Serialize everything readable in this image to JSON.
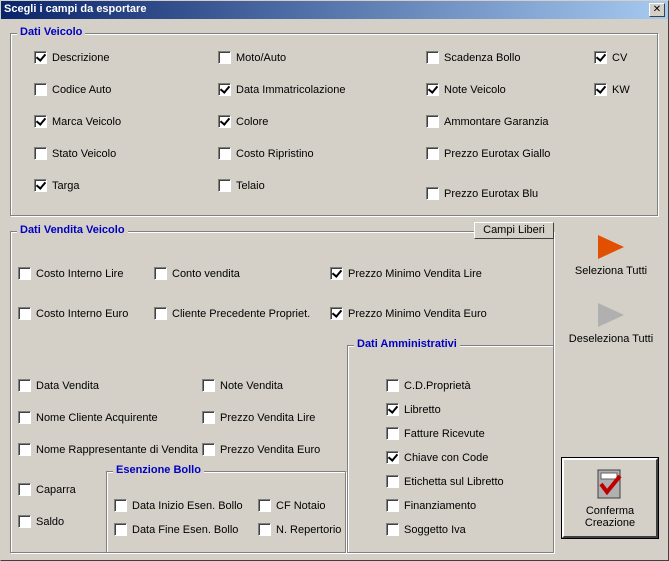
{
  "window": {
    "title": "Scegli i campi da esportare",
    "close_glyph": "✕"
  },
  "groups": {
    "veicolo": {
      "title": "Dati Veicolo"
    },
    "vendita": {
      "title": "Dati Vendita Veicolo"
    },
    "amministrativi": {
      "title": "Dati Amministrativi"
    },
    "esenzione": {
      "title": "Esenzione Bollo"
    }
  },
  "buttons": {
    "campi_liberi": "Campi Liberi",
    "seleziona_tutti": "Seleziona Tutti",
    "deseleziona_tutti": "Deseleziona Tutti",
    "conferma_line1": "Conferma",
    "conferma_line2": "Creazione"
  },
  "checkboxes": {
    "descrizione": {
      "label": "Descrizione",
      "checked": true
    },
    "codice_auto": {
      "label": "Codice Auto",
      "checked": false
    },
    "marca_veicolo": {
      "label": "Marca Veicolo",
      "checked": true
    },
    "stato_veicolo": {
      "label": "Stato Veicolo",
      "checked": false
    },
    "targa": {
      "label": "Targa",
      "checked": true
    },
    "moto_auto": {
      "label": "Moto/Auto",
      "checked": false
    },
    "data_immatricolazione": {
      "label": "Data Immatricolazione",
      "checked": true
    },
    "colore": {
      "label": "Colore",
      "checked": true
    },
    "costo_ripristino": {
      "label": "Costo Ripristino",
      "checked": false
    },
    "telaio": {
      "label": "Telaio",
      "checked": false
    },
    "scadenza_bollo": {
      "label": "Scadenza Bollo",
      "checked": false
    },
    "note_veicolo": {
      "label": "Note Veicolo",
      "checked": true
    },
    "ammontare_garanzia": {
      "label": "Ammontare Garanzia",
      "checked": false
    },
    "prezzo_eurotax_giallo": {
      "label": "Prezzo Eurotax Giallo",
      "checked": false
    },
    "prezzo_eurotax_blu": {
      "label": "Prezzo Eurotax Blu",
      "checked": false
    },
    "cv": {
      "label": "CV",
      "checked": true
    },
    "kw": {
      "label": "KW",
      "checked": true
    },
    "costo_interno_lire": {
      "label": "Costo Interno Lire",
      "checked": false
    },
    "costo_interno_euro": {
      "label": "Costo Interno Euro",
      "checked": false
    },
    "conto_vendita": {
      "label": "Conto vendita",
      "checked": false
    },
    "cliente_precedente": {
      "label": "Cliente Precedente Propriet.",
      "checked": false
    },
    "prezzo_minimo_lire": {
      "label": "Prezzo Minimo Vendita Lire",
      "checked": true
    },
    "prezzo_minimo_euro": {
      "label": "Prezzo Minimo Vendita Euro",
      "checked": true
    },
    "data_vendita": {
      "label": "Data Vendita",
      "checked": false
    },
    "nome_cliente": {
      "label": "Nome Cliente Acquirente",
      "checked": false
    },
    "nome_rappresentante": {
      "label": "Nome Rappresentante di Vendita",
      "checked": false
    },
    "caparra": {
      "label": "Caparra",
      "checked": false
    },
    "saldo": {
      "label": "Saldo",
      "checked": false
    },
    "note_vendita": {
      "label": "Note Vendita",
      "checked": false
    },
    "prezzo_vendita_lire": {
      "label": "Prezzo Vendita Lire",
      "checked": false
    },
    "prezzo_vendita_euro": {
      "label": "Prezzo Vendita Euro",
      "checked": false
    },
    "data_inizio_esen": {
      "label": "Data Inizio Esen. Bollo",
      "checked": false
    },
    "data_fine_esen": {
      "label": "Data Fine Esen. Bollo",
      "checked": false
    },
    "cf_notaio": {
      "label": "CF Notaio",
      "checked": false
    },
    "n_repertorio": {
      "label": "N. Repertorio",
      "checked": false
    },
    "cd_proprieta": {
      "label": "C.D.Proprietà",
      "checked": false
    },
    "libretto": {
      "label": "Libretto",
      "checked": true
    },
    "fatture_ricevute": {
      "label": "Fatture Ricevute",
      "checked": false
    },
    "chiave_con_code": {
      "label": "Chiave con Code",
      "checked": true
    },
    "etichetta_libretto": {
      "label": "Etichetta sul Libretto",
      "checked": false
    },
    "finanziamento": {
      "label": "Finanziamento",
      "checked": false
    },
    "soggetto_iva": {
      "label": "Soggetto Iva",
      "checked": false
    }
  }
}
